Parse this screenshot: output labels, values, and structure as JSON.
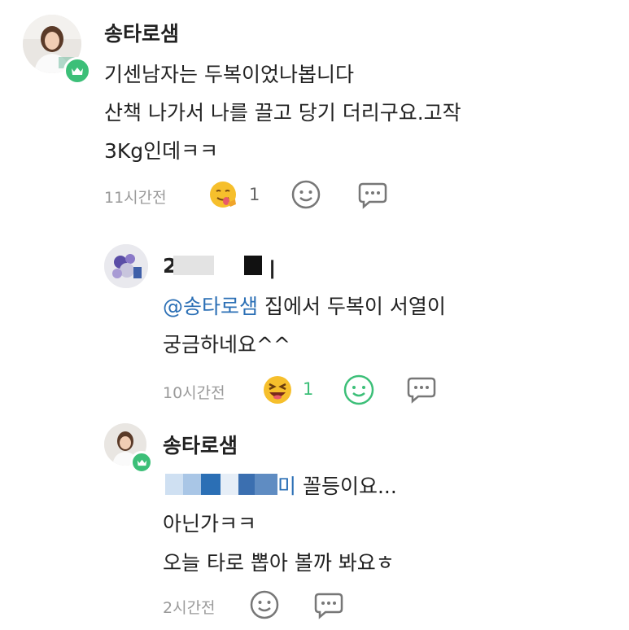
{
  "comments": [
    {
      "author": "송타로샘",
      "lines": [
        "기센남자는 두복이었나봅니다",
        "산책 나가서  나를 끌고 당기 더리구요.고작",
        "3Kg인데ㅋㅋ"
      ],
      "time": "11시간전",
      "reaction_count": "1",
      "reaction_icon": "tongue-emoji-icon",
      "badge": "crown-icon"
    },
    {
      "author_visible": "2",
      "author_tail": "ㅣ",
      "mention": "@송타로샘",
      "line1_rest": " 집에서 두복이 서열이",
      "line2": "궁금하네요^^",
      "time": "10시간전",
      "reaction_count": "1",
      "reaction_icon": "laughing-emoji-icon"
    },
    {
      "author": "송타로샘",
      "mention_tail": "미",
      "line1_rest": " 꼴등이요...",
      "line2": "아닌가ㅋㅋ",
      "line3": "오늘 타로 뽑아 볼까 봐요ㅎ",
      "time": "2시간전",
      "badge": "crown-icon"
    }
  ],
  "colors": {
    "accent_green": "#3cbf78",
    "mention_blue": "#2b6fb5",
    "time_gray": "#9a9a9a"
  }
}
